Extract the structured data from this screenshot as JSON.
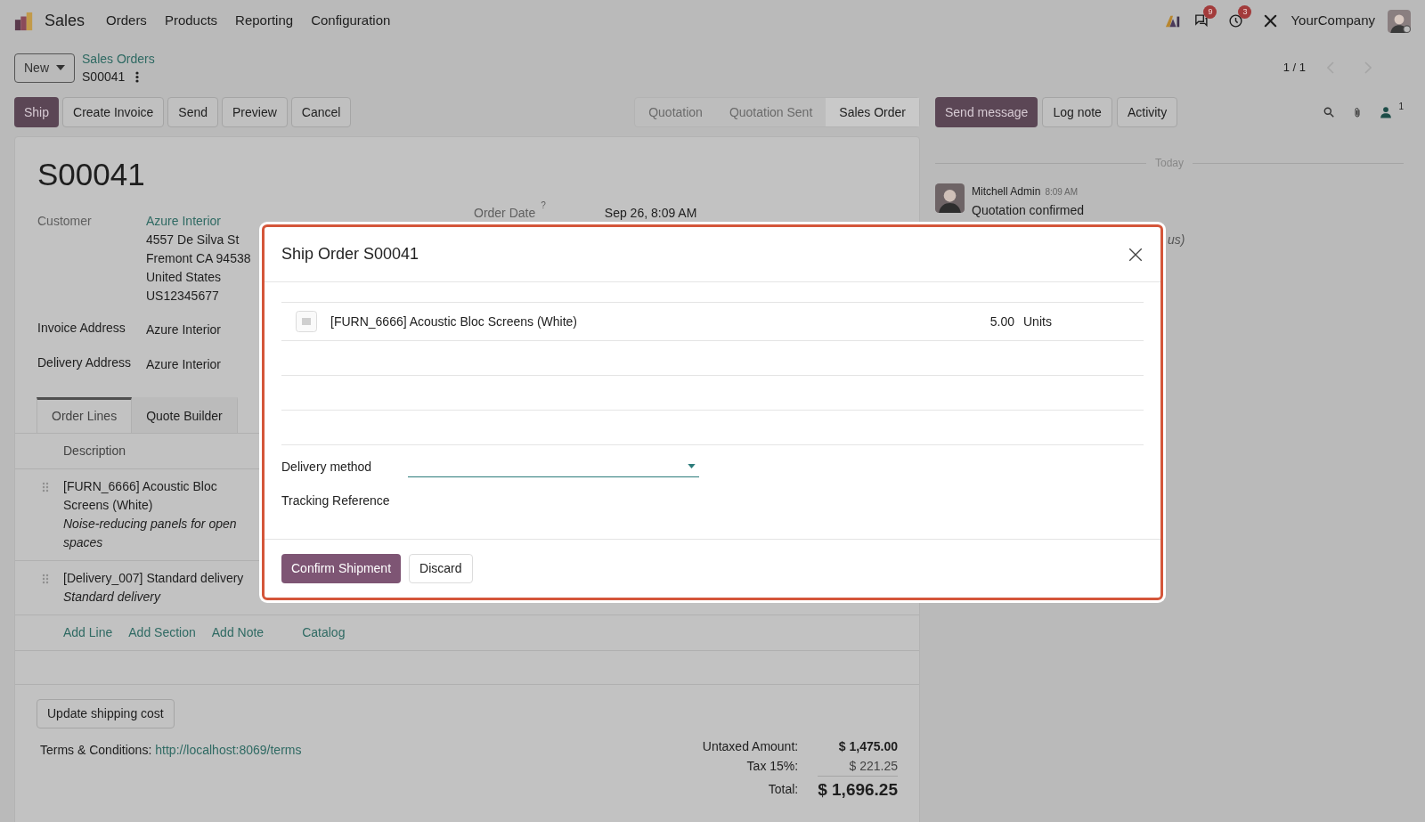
{
  "app": {
    "name": "Sales",
    "menu": [
      "Orders",
      "Products",
      "Reporting",
      "Configuration"
    ]
  },
  "systray": {
    "messages_count": "9",
    "activities_count": "3",
    "company": "YourCompany"
  },
  "control_panel": {
    "new_button": "New",
    "breadcrumb": "Sales Orders",
    "record": "S00041",
    "pager": "1 / 1"
  },
  "actions": [
    {
      "label": "Ship",
      "primary": true
    },
    {
      "label": "Create Invoice",
      "primary": false
    },
    {
      "label": "Send",
      "primary": false
    },
    {
      "label": "Preview",
      "primary": false
    },
    {
      "label": "Cancel",
      "primary": false
    }
  ],
  "statusbar": [
    {
      "label": "Quotation",
      "selected": false
    },
    {
      "label": "Quotation Sent",
      "selected": false
    },
    {
      "label": "Sales Order",
      "selected": true
    }
  ],
  "chatter_buttons": [
    {
      "label": "Send message",
      "primary": true
    },
    {
      "label": "Log note",
      "primary": false
    },
    {
      "label": "Activity",
      "primary": false
    }
  ],
  "followers_count": "1",
  "form": {
    "title": "S00041",
    "customer": {
      "label": "Customer",
      "link": "Azure Interior",
      "lines": [
        "4557 De Silva St",
        "Fremont CA 94538",
        "United States",
        "US12345677"
      ]
    },
    "fields": [
      {
        "label": "Invoice Address",
        "value": "Azure Interior"
      },
      {
        "label": "Delivery Address",
        "value": "Azure Interior"
      }
    ],
    "order_date": {
      "label": "Order Date",
      "help": "?",
      "value": "Sep 26, 8:09 AM"
    }
  },
  "tabs": [
    {
      "label": "Order Lines",
      "selected": true
    },
    {
      "label": "Quote Builder",
      "selected": false
    }
  ],
  "order_lines": {
    "column": "Description",
    "rows": [
      {
        "name": "[FURN_6666] Acoustic Bloc Screens (White)",
        "note": "Noise-reducing panels for open spaces"
      },
      {
        "name": "[Delivery_007] Standard delivery",
        "note": "Standard delivery"
      }
    ]
  },
  "line_actions": [
    "Add Line",
    "Add Section",
    "Add Note",
    "Catalog"
  ],
  "update_shipping_button": "Update shipping cost",
  "terms": {
    "label": "Terms & Conditions:",
    "link": "http://localhost:8069/terms"
  },
  "totals": [
    {
      "label": "Untaxed Amount:",
      "value": "$ 1,475.00",
      "kind": "subtotal"
    },
    {
      "label": "Tax 15%:",
      "value": "$ 221.25",
      "kind": "tax"
    },
    {
      "label": "Total:",
      "value": "$ 1,696.25",
      "kind": "total"
    }
  ],
  "chatter": {
    "date_separator": "Today",
    "messages": [
      {
        "author": "Mitchell Admin",
        "time": "8:09 AM",
        "body": "Quotation confirmed"
      }
    ],
    "partial_text": "us)"
  },
  "dialog": {
    "title": "Ship Order S00041",
    "lines": [
      {
        "product": "[FURN_6666] Acoustic Bloc Screens (White)",
        "quantity": "5.00",
        "uom": "Units"
      }
    ],
    "fields": [
      {
        "label": "Delivery method",
        "kind": "select"
      },
      {
        "label": "Tracking Reference",
        "kind": "text"
      }
    ],
    "buttons": [
      {
        "label": "Confirm Shipment",
        "primary": true
      },
      {
        "label": "Discard",
        "primary": false
      }
    ]
  }
}
